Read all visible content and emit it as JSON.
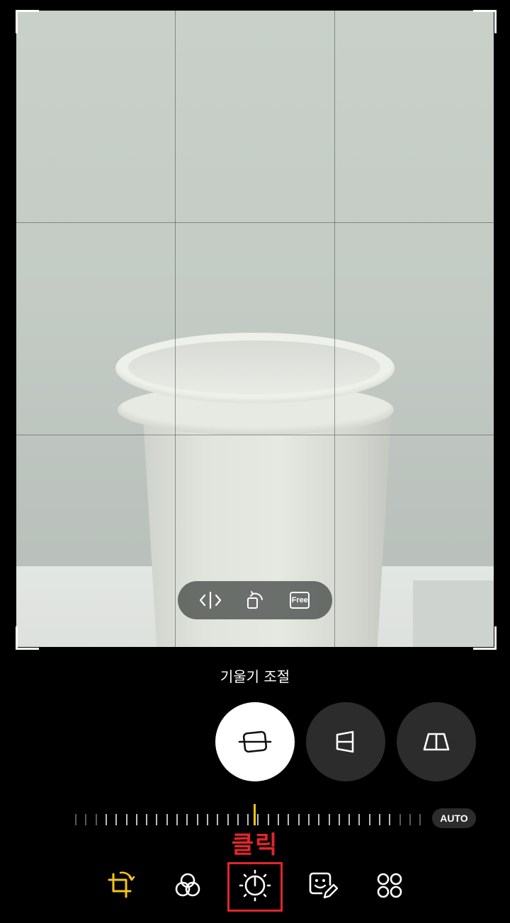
{
  "editor": {
    "mode_title": "기울기 조절",
    "auto_label": "AUTO",
    "free_label": "Free"
  },
  "annotation": {
    "text": "클릭",
    "color": "#e0262b"
  },
  "colors": {
    "active_tab": "#f5c518",
    "needle": "#f5c518",
    "selected_mode_bg": "#ffffff",
    "mode_bg": "#2c2c2c"
  },
  "toolbar_pill": {
    "items": [
      "flip-icon",
      "rotate-icon",
      "free-aspect-icon"
    ]
  },
  "transform_modes": {
    "items": [
      "straighten-icon",
      "vertical-perspective-icon",
      "horizontal-perspective-icon"
    ],
    "selected": "straighten-icon"
  },
  "bottom_tabs": {
    "items": [
      "transform-icon",
      "filter-icon",
      "adjust-icon",
      "decorate-icon",
      "more-icon"
    ],
    "active": "transform-icon",
    "highlighted": "adjust-icon"
  }
}
